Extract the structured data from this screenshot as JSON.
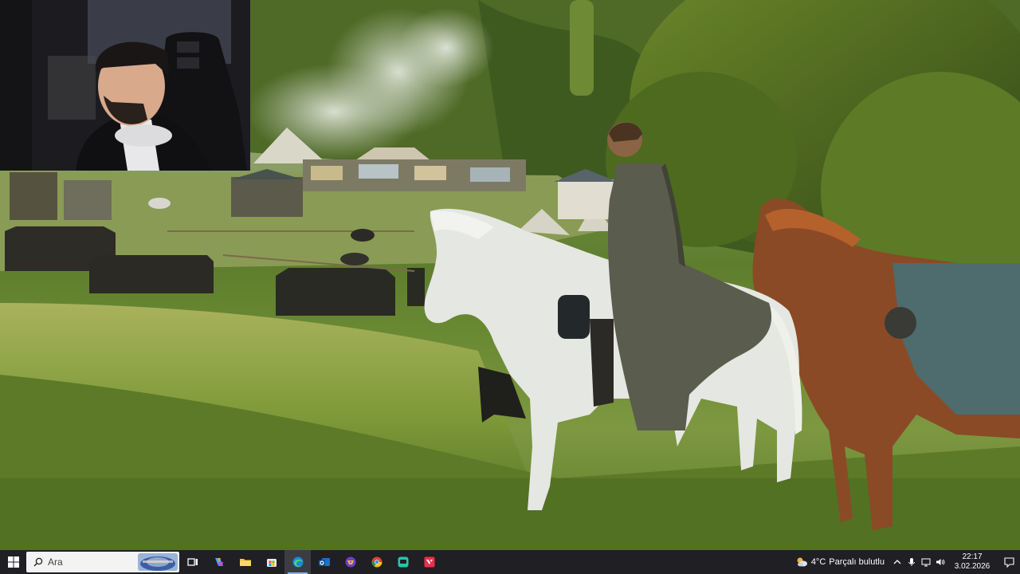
{
  "taskbar": {
    "search": {
      "placeholder": "Ara"
    },
    "pinned_apps": [
      {
        "name": "task-view",
        "icon": "task-view-icon"
      },
      {
        "name": "copilot",
        "icon": "copilot-icon"
      },
      {
        "name": "file-explorer",
        "icon": "folder-icon"
      },
      {
        "name": "microsoft-store",
        "icon": "store-icon"
      },
      {
        "name": "edge",
        "icon": "edge-icon",
        "active": true
      },
      {
        "name": "outlook",
        "icon": "outlook-icon"
      },
      {
        "name": "game-app",
        "icon": "game-icon"
      },
      {
        "name": "chrome",
        "icon": "chrome-icon"
      },
      {
        "name": "chat-app",
        "icon": "chat-icon"
      },
      {
        "name": "valorant",
        "icon": "valorant-icon"
      }
    ],
    "weather": {
      "temperature": "4°C",
      "condition": "Parçalı bulutlu"
    },
    "clock": {
      "time": "22:17",
      "date": "3.02.2026"
    }
  },
  "colors": {
    "taskbar_bg": "#1f1f24",
    "accent": "#7fb4ee"
  }
}
